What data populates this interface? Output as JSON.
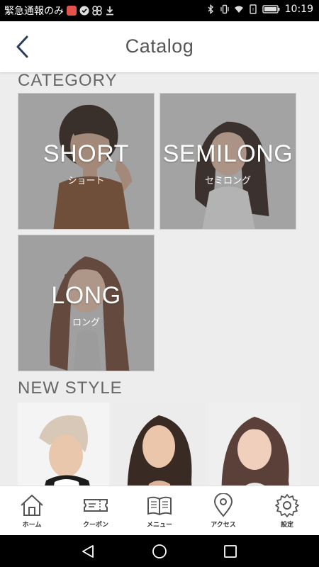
{
  "status_bar": {
    "left_text": "緊急通報のみ",
    "time": "10:19",
    "icons": [
      "mail-badge-icon",
      "check-badge-icon",
      "fan-icon",
      "download-icon",
      "bluetooth-icon",
      "vibrate-icon",
      "wifi-icon",
      "sim-icon",
      "battery-icon"
    ]
  },
  "header": {
    "title": "Catalog",
    "back_icon": "chevron-left-icon"
  },
  "category": {
    "heading": "CATEGORY",
    "tiles": [
      {
        "en": "SHORT",
        "jp": "ショート"
      },
      {
        "en": "SEMILONG",
        "jp": "セミロング"
      },
      {
        "en": "LONG",
        "jp": "ロング"
      }
    ]
  },
  "new_style": {
    "heading": "NEW STYLE"
  },
  "bottom_nav": {
    "items": [
      {
        "label": "ホーム",
        "icon": "home-icon"
      },
      {
        "label": "クーポン",
        "icon": "ticket-icon"
      },
      {
        "label": "メニュー",
        "icon": "book-icon"
      },
      {
        "label": "アクセス",
        "icon": "map-pin-icon"
      },
      {
        "label": "設定",
        "icon": "gear-icon"
      }
    ]
  },
  "system_nav": {
    "icons": [
      "back-triangle-icon",
      "home-circle-icon",
      "recents-square-icon"
    ]
  },
  "colors": {
    "background": "#ededed",
    "header": "#ffffff",
    "text_gray": "#666666",
    "status_bar": "#000000"
  }
}
